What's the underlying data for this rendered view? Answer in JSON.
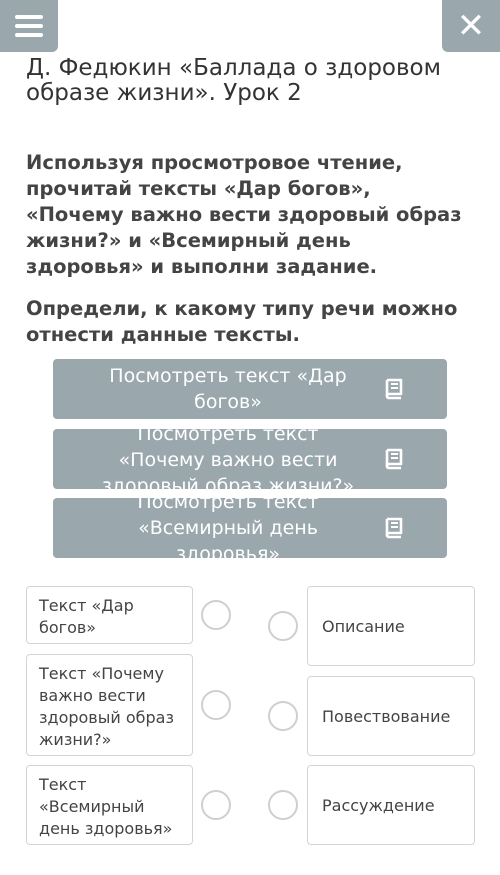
{
  "header": {
    "menu_icon": "hamburger-menu-icon",
    "close_icon": "close-icon",
    "close_glyph": "✕",
    "title": "Д. Федюкин «Баллада о здоровом образе жизни». Урок 2"
  },
  "task": {
    "instruction": "Используя просмотровое чтение, прочитай тексты «Дар богов», «Почему важно вести здоровый образ жизни?» и «Всемирный день здоровья» и выполни задание.",
    "question": "Определи, к какому типу речи можно отнести данные тексты."
  },
  "text_buttons": [
    {
      "label": "Посмотреть текст «Дар богов»",
      "icon": "book-icon"
    },
    {
      "label": "Посмотреть текст «Почему важно вести здоровый образ жизни?»",
      "icon": "book-icon"
    },
    {
      "label": "Посмотреть текст «Всемирный день здоровья»",
      "icon": "book-icon"
    }
  ],
  "matching": {
    "left": [
      "Текст «Дар богов»",
      "Текст «Почему важно вести здоровый образ жизни?»",
      "Текст «Всемирный день здоровья»"
    ],
    "right": [
      "Описание",
      "Повествование",
      "Рассуждение"
    ]
  },
  "colors": {
    "accent_gray": "#9aa7ad",
    "text_dark": "#444444",
    "border": "#d4d4d4"
  }
}
